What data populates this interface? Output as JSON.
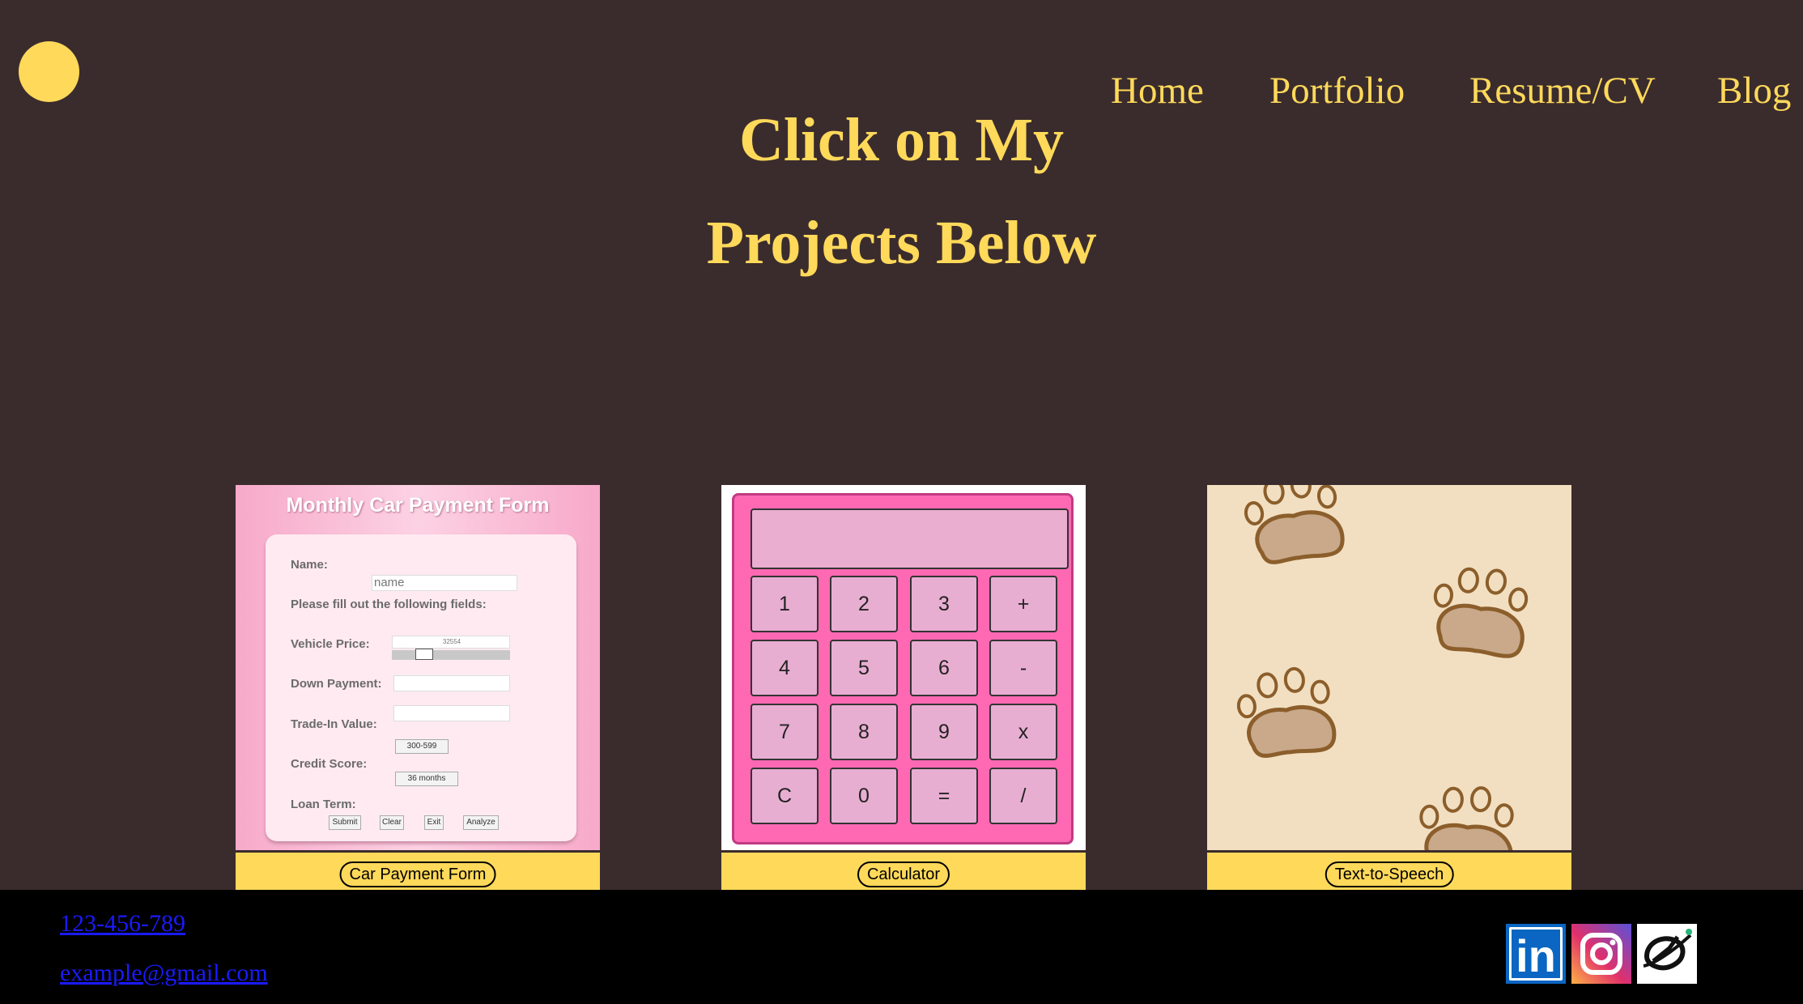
{
  "nav": {
    "items": [
      {
        "label": "Home"
      },
      {
        "label": "Portfolio"
      },
      {
        "label": "Resume/CV"
      },
      {
        "label": "Blog"
      }
    ]
  },
  "hero": {
    "line1": "Click on My",
    "line2": "Projects Below"
  },
  "projects": [
    {
      "label": "Car Payment Form",
      "thumb": {
        "title": "Monthly Car Payment Form",
        "name_label": "Name:",
        "name_placeholder": "name",
        "instructions": "Please fill out the following fields:",
        "vehicle_price_label": "Vehicle Price:",
        "vehicle_price_value": "32554",
        "down_payment_label": "Down Payment:",
        "trade_in_label": "Trade-In Value:",
        "credit_score_label": "Credit Score:",
        "credit_score_value": "300-599",
        "loan_term_label": "Loan Term:",
        "loan_term_value": "36 months",
        "buttons": [
          "Submit",
          "Clear",
          "Exit",
          "Analyze"
        ]
      }
    },
    {
      "label": "Calculator",
      "thumb": {
        "keys": [
          "1",
          "2",
          "3",
          "+",
          "4",
          "5",
          "6",
          "-",
          "7",
          "8",
          "9",
          "x",
          "C",
          "0",
          "=",
          "/"
        ]
      }
    },
    {
      "label": "Text-to-Speech"
    }
  ],
  "footer": {
    "phone": "123-456-789",
    "email": "example@gmail.com",
    "social": [
      {
        "icon": "linkedin-icon",
        "text": "in",
        "color": "#0a66c2"
      },
      {
        "icon": "instagram-icon",
        "color": "#c13584"
      },
      {
        "icon": "medium-icon",
        "color": "#ffffff"
      }
    ]
  },
  "colors": {
    "background": "#3a2c2d",
    "accent": "#ffd95a",
    "footer": "#000000",
    "link": "#1a1aff"
  }
}
